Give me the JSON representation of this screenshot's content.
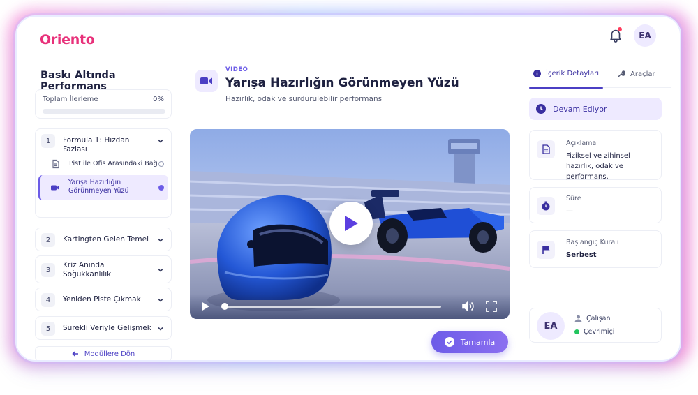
{
  "app": {
    "logo": "Oriento",
    "user_initials": "EA"
  },
  "colors": {
    "brand": "#e8317a",
    "accent": "#6c5ce7",
    "online": "#22c55e"
  },
  "course": {
    "title": "Baskı Altında Performans",
    "progress_label": "Toplam İlerleme",
    "progress_value": "0%",
    "progress_fraction": 0
  },
  "modules": [
    {
      "num": "1",
      "name": "Formula 1: Hızdan Fazlası",
      "expanded": true,
      "lessons": [
        {
          "name": "Pist ile Ofis Arasındaki Bağ",
          "icon": "document-icon",
          "active": false
        },
        {
          "name": "Yarışa Hazırlığın Görünmeyen Yüzü",
          "icon": "video-icon",
          "active": true
        }
      ]
    },
    {
      "num": "2",
      "name": "Kartingten Gelen Temel"
    },
    {
      "num": "3",
      "name": "Kriz Anında Soğukkanlılık"
    },
    {
      "num": "4",
      "name": "Yeniden Piste Çıkmak"
    },
    {
      "num": "5",
      "name": "Sürekli Veriyle Gelişmek"
    }
  ],
  "back_label": "Modüllere Dön",
  "lesson": {
    "kicker": "VIDEO",
    "title": "Yarışa Hazırlığın Görünmeyen Yüzü",
    "subtitle": "Hazırlık, odak ve sürdürülebilir performans",
    "complete_label": "Tamamla",
    "playback_fraction": 0
  },
  "details": {
    "tab_details": "İçerik Detayları",
    "tab_tools": "Araçlar",
    "status": "Devam Ediyor",
    "description_label": "Açıklama",
    "description_value": "Fiziksel ve zihinsel hazırlık, odak ve performans.",
    "duration_label": "Süre",
    "duration_value": "—",
    "start_rule_label": "Başlangıç Kuralı",
    "start_rule_value": "Serbest",
    "user_initials": "EA",
    "user_role": "Çalışan",
    "user_status": "Çevrimiçi"
  }
}
